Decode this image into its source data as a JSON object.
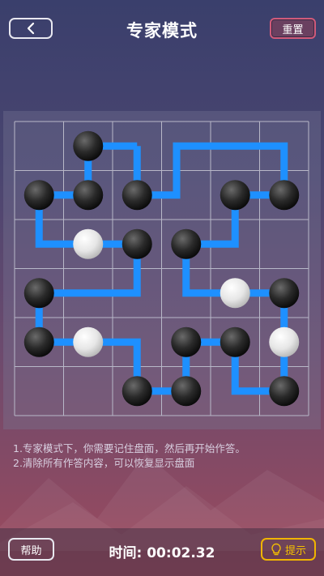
{
  "header": {
    "title": "专家模式",
    "reset_label": "重置"
  },
  "board": {
    "grid_size": 6,
    "line_color": "#1e90ff",
    "stones": [
      {
        "col": 1,
        "row": 0,
        "color": "black"
      },
      {
        "col": 0,
        "row": 1,
        "color": "black"
      },
      {
        "col": 1,
        "row": 1,
        "color": "black"
      },
      {
        "col": 2,
        "row": 1,
        "color": "black"
      },
      {
        "col": 4,
        "row": 1,
        "color": "black"
      },
      {
        "col": 5,
        "row": 1,
        "color": "black"
      },
      {
        "col": 1,
        "row": 2,
        "color": "white"
      },
      {
        "col": 2,
        "row": 2,
        "color": "black"
      },
      {
        "col": 3,
        "row": 2,
        "color": "black"
      },
      {
        "col": 0,
        "row": 3,
        "color": "black"
      },
      {
        "col": 4,
        "row": 3,
        "color": "white"
      },
      {
        "col": 5,
        "row": 3,
        "color": "black"
      },
      {
        "col": 0,
        "row": 4,
        "color": "black"
      },
      {
        "col": 1,
        "row": 4,
        "color": "white"
      },
      {
        "col": 3,
        "row": 4,
        "color": "black"
      },
      {
        "col": 4,
        "row": 4,
        "color": "black"
      },
      {
        "col": 5,
        "row": 4,
        "color": "white"
      },
      {
        "col": 2,
        "row": 5,
        "color": "black"
      },
      {
        "col": 3,
        "row": 5,
        "color": "black"
      },
      {
        "col": 5,
        "row": 5,
        "color": "black"
      }
    ]
  },
  "instructions": [
    "1.专家模式下，你需要记住盘面，然后再开始作答。",
    "2.清除所有作答内容，可以恢复显示盘面"
  ],
  "footer": {
    "help_label": "帮助",
    "timer_label": "时间: 00:02.32",
    "hint_label": "提示"
  },
  "colors": {
    "accent_reset": "#d05a7a",
    "accent_hint": "#f0b400"
  }
}
